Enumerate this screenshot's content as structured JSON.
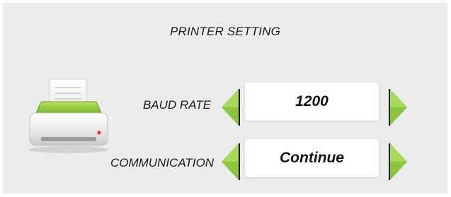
{
  "header": {
    "title": "PRINTER SETTING"
  },
  "icons": {
    "printer": "printer-icon",
    "left_arrow": "triangle-left-icon",
    "right_arrow": "triangle-right-icon"
  },
  "colors": {
    "accent_green": "#8cc63f",
    "panel_background": "#ececec",
    "value_background": "#ffffff"
  },
  "settings": [
    {
      "label": "BAUD RATE",
      "value": "1200"
    },
    {
      "label": "COMMUNICATION",
      "value": "Continue"
    }
  ]
}
